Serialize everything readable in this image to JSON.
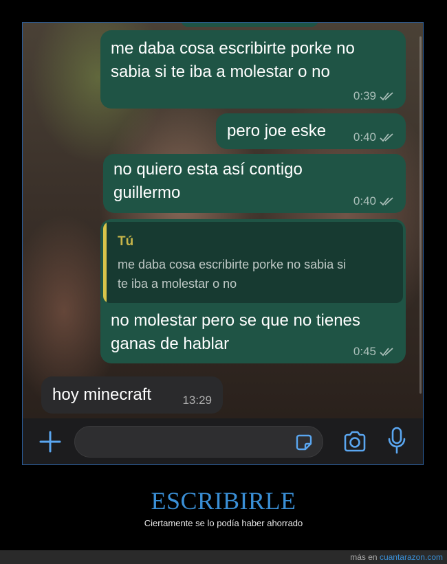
{
  "chat": {
    "messages": [
      {
        "direction": "out",
        "text_line1": "me daba cosa escribirte porke no",
        "text_line2": "sabia si te iba a molestar o no",
        "time": "0:39"
      },
      {
        "direction": "out",
        "text": "pero joe eske",
        "time": "0:40"
      },
      {
        "direction": "out",
        "text_line1": "no quiero esta así contigo",
        "text_line2": "guillermo",
        "time": "0:40"
      },
      {
        "direction": "out",
        "quote_author": "Tú",
        "quote_line1": "me daba cosa escribirte porke no sabia si",
        "quote_line2": "te iba a molestar o no",
        "text_line1": "no molestar pero se que no tienes",
        "text_line2": "ganas de hablar",
        "time": "0:45"
      },
      {
        "direction": "in",
        "text": "hoy minecraft",
        "time": "13:29"
      }
    ]
  },
  "input_bar": {
    "icons": [
      "plus-icon",
      "sticker-icon",
      "camera-icon",
      "microphone-icon"
    ],
    "accent": "#5aa6f0"
  },
  "caption": {
    "title": "ESCRIBIRLE",
    "subtitle": "Ciertamente se lo podía haber ahorrado"
  },
  "footer": {
    "prefix": "más en",
    "link": "cuantarazon.com"
  },
  "colors": {
    "outgoing_bubble": "#1f5445",
    "incoming_bubble": "#2a2a2c",
    "quote_accent": "#d8c44a",
    "caption_title": "#3a8fd6"
  }
}
